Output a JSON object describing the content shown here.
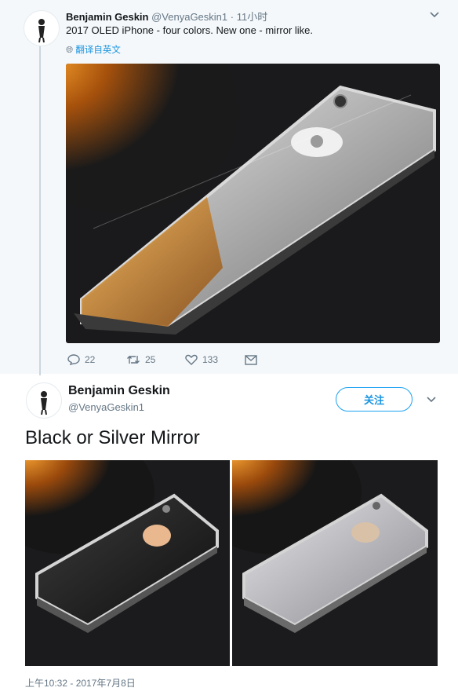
{
  "parent_tweet": {
    "author_name": "Benjamin Geskin",
    "author_handle": "@VenyaGeskin1",
    "separator": "·",
    "time_ago": "11小时",
    "text": "2017 OLED iPhone - four colors. New one - mirror like.",
    "translate_label": "翻译自英文",
    "actions": {
      "reply_count": "22",
      "retweet_count": "25",
      "like_count": "133"
    },
    "media_icon": "mirror-iphone-photo"
  },
  "main_tweet": {
    "author_name": "Benjamin Geskin",
    "author_handle": "@VenyaGeskin1",
    "follow_label": "关注",
    "text": "Black or Silver Mirror",
    "timestamp": "上午10:32 - 2017年7月8日",
    "media": [
      {
        "icon": "black-mirror-iphone-photo"
      },
      {
        "icon": "silver-mirror-iphone-photo"
      }
    ]
  },
  "colors": {
    "accent": "#1da1f2",
    "link": "#1b95e0",
    "muted": "#657786",
    "parent_bg": "#f5f8fa"
  }
}
